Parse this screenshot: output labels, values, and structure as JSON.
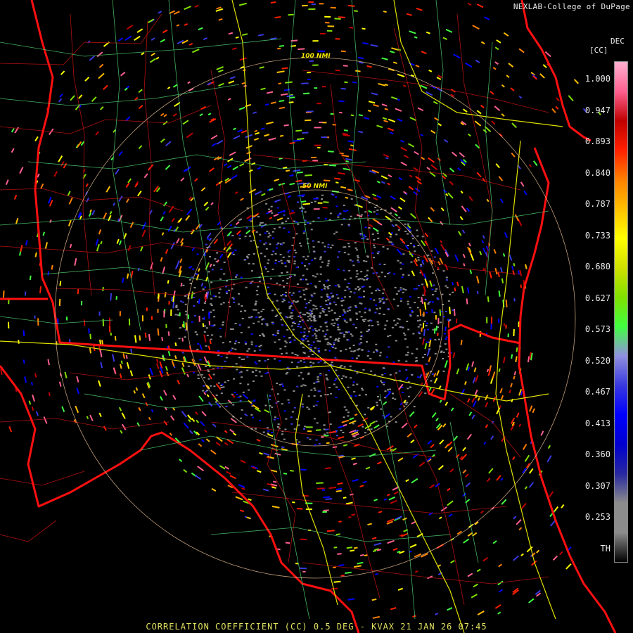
{
  "header": {
    "credit": "NEXLAB-College of DuPage"
  },
  "units": {
    "line1": "DEC",
    "line2": "[CC]"
  },
  "rings": [
    {
      "label": "100 NMI"
    },
    {
      "label": "50 NMI"
    }
  ],
  "colorbar": {
    "stops": [
      "#000000",
      "#8c8c8c",
      "#8c8c8c",
      "#2828a0",
      "#0000d0",
      "#0000ff",
      "#3838e0",
      "#9090e0",
      "#40ff40",
      "#80e000",
      "#d0e000",
      "#ffff00",
      "#ffc000",
      "#ff8000",
      "#ff2000",
      "#c00000",
      "#ff6090",
      "#ffb0d0"
    ],
    "ticks": [
      "1.000",
      "0.947",
      "0.893",
      "0.840",
      "0.787",
      "0.733",
      "0.680",
      "0.627",
      "0.573",
      "0.520",
      "0.467",
      "0.413",
      "0.360",
      "0.307",
      "0.253",
      "TH"
    ]
  },
  "footer": {
    "caption": "CORRELATION COEFFICIENT (CC) 0.5 DEG - KVAX 21 JAN 26 07:45"
  }
}
